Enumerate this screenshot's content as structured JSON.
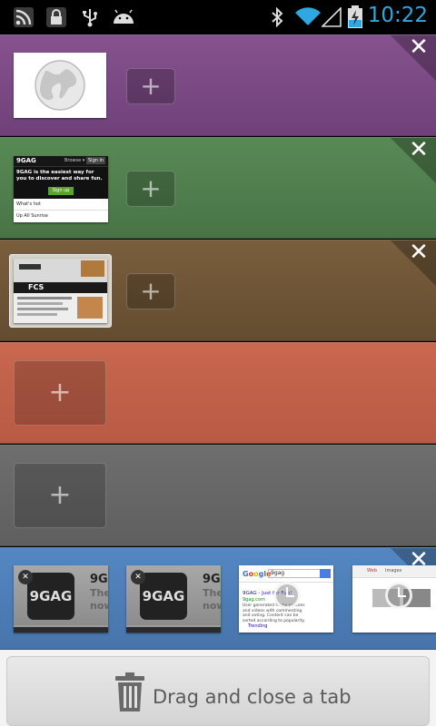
{
  "status_bar": {
    "time": "10:22",
    "icons": [
      "rss-icon",
      "lock-icon",
      "usb-icon",
      "android-icon",
      "bluetooth-icon",
      "wifi-icon",
      "signal-icon",
      "battery-charging-icon"
    ],
    "clock_color": "#2fa7e0"
  },
  "tab_groups": [
    {
      "color": "#7b4a86",
      "close_label": "✕",
      "add_label": "+",
      "tabs": [
        {
          "type": "blank-globe"
        }
      ]
    },
    {
      "color": "#4f7d4c",
      "close_label": "✕",
      "add_label": "+",
      "tabs": [
        {
          "type": "page",
          "site": "9GAG",
          "headline": "9GAG is the easiest way for you to discover and share fun.",
          "button": "Sign up",
          "nav_browse": "Browse ▾",
          "nav_signin": "Sign in",
          "items": [
            "What's hot",
            "Up All Sunrise"
          ]
        }
      ]
    },
    {
      "color": "#6e5537",
      "close_label": "✕",
      "add_label": "+",
      "tabs": [
        {
          "type": "page",
          "site": "FCS",
          "selected": true
        }
      ]
    },
    {
      "color": "#c2604a",
      "add_label": "+",
      "tabs": []
    },
    {
      "color": "#666666",
      "add_label": "+",
      "tabs": []
    },
    {
      "color": "#4d7db8",
      "close_label": "✕",
      "tabs": [
        {
          "type": "9gag",
          "logo": "9GAG",
          "side_text": "9GA",
          "sub1": "The",
          "sub2": "now"
        },
        {
          "type": "9gag",
          "logo": "9GAG",
          "side_text": "9GA",
          "sub1": "The",
          "sub2": "now"
        },
        {
          "type": "google",
          "search": "9gag",
          "result_title": "9GAG - Just for Fun!",
          "result_url": "9gag.com",
          "result_snippet": "User generated funny pictures and videos with commenting and voting. Content can be sorted according to popularity.",
          "footer": "Trending"
        },
        {
          "type": "google-images",
          "tab1": "Web",
          "tab2": "Images"
        }
      ]
    }
  ],
  "trash": {
    "label": "Drag and close a tab"
  }
}
